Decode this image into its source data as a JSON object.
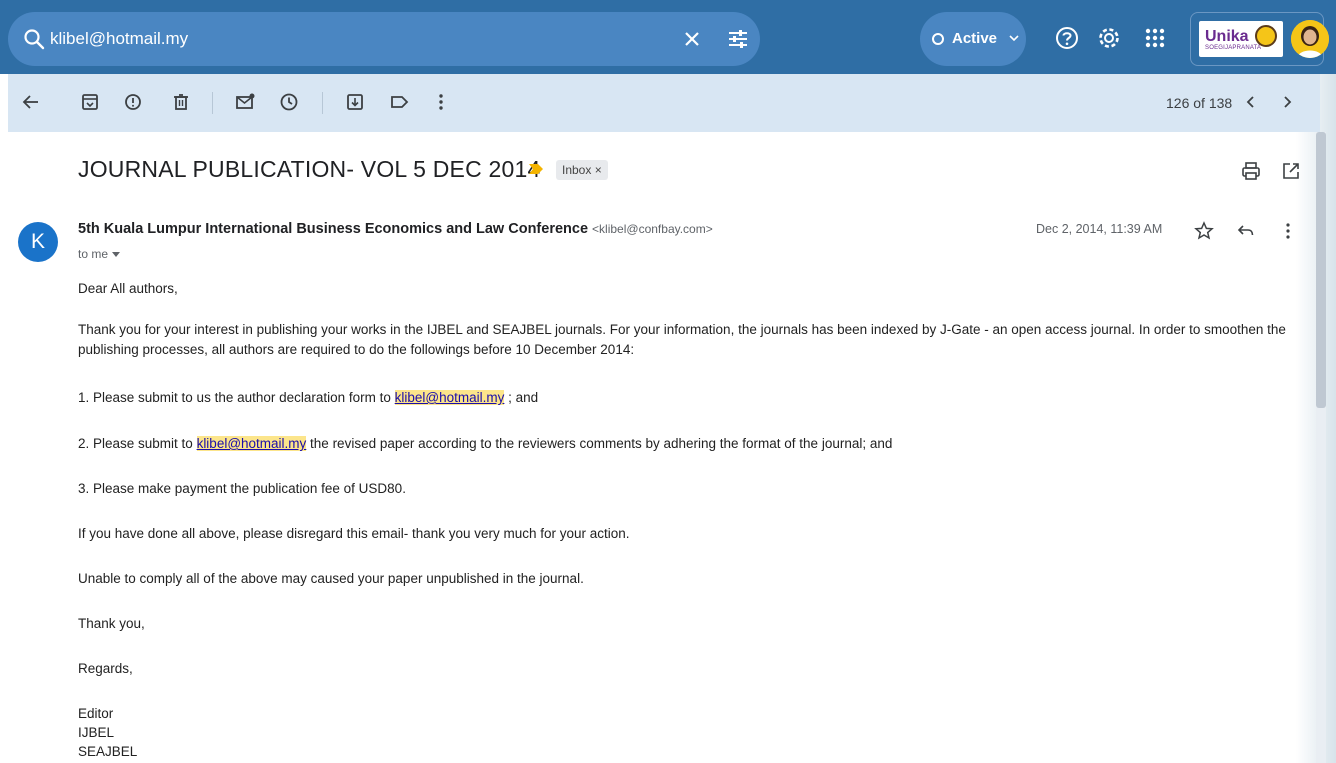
{
  "search": {
    "query": "klibel@hotmail.my"
  },
  "status": {
    "label": "Active"
  },
  "account": {
    "org_logo_text": "Unika",
    "org_logo_sub": "SOEGIJAPRANATA"
  },
  "toolbar": {
    "pager": "126 of 138"
  },
  "email": {
    "subject": "JOURNAL PUBLICATION- VOL 5 DEC 2014",
    "label_chip": "Inbox ×",
    "sender_initial": "K",
    "sender_name": "5th Kuala Lumpur International Business Economics and Law Conference",
    "sender_email": "<klibel@confbay.com>",
    "to": "to me",
    "date": "Dec 2, 2014, 11:39 AM",
    "body": {
      "greeting": "Dear All authors,",
      "intro": "Thank you for your interest in publishing your works in the IJBEL and SEAJBEL journals. For your information, the journals has been indexed by J-Gate - an open access journal. In order to smoothen the publishing processes, all authors are required to do the followings before 10 December 2014:",
      "item1_pre": "1. Please submit to us the author declaration form to ",
      "item1_link": "klibel@hotmail.my",
      "item1_post": " ; and",
      "item2_pre": "2. Please submit to ",
      "item2_link": "klibel@hotmail.my",
      "item2_post": " the revised paper according to the reviewers comments by adhering the format of the journal; and",
      "item3": "3. Please make payment the publication fee of USD80.",
      "note1": "If you have done all above, please disregard this email- thank you very much for your action.",
      "note2": "Unable to comply all of the above may caused your paper unpublished in the journal.",
      "thanks": "Thank you,",
      "regards": "Regards,",
      "sig1": "Editor",
      "sig2": "IJBEL",
      "sig3": "SEAJBEL"
    }
  },
  "colors": {
    "topbar": "#2f6ea5",
    "toolbar": "#d8e6f3",
    "avatar": "#1a73c9",
    "highlight": "#fce58b"
  },
  "icons": [
    "search-icon",
    "clear-icon",
    "tune-icon",
    "help-icon",
    "gear-icon",
    "apps-icon",
    "back-icon",
    "archive-icon",
    "spam-icon",
    "delete-icon",
    "mark-unread-icon",
    "snooze-icon",
    "move-to-icon",
    "label-icon",
    "more-icon",
    "prev-icon",
    "next-icon",
    "print-icon",
    "open-new-window-icon",
    "star-icon",
    "reply-icon"
  ]
}
